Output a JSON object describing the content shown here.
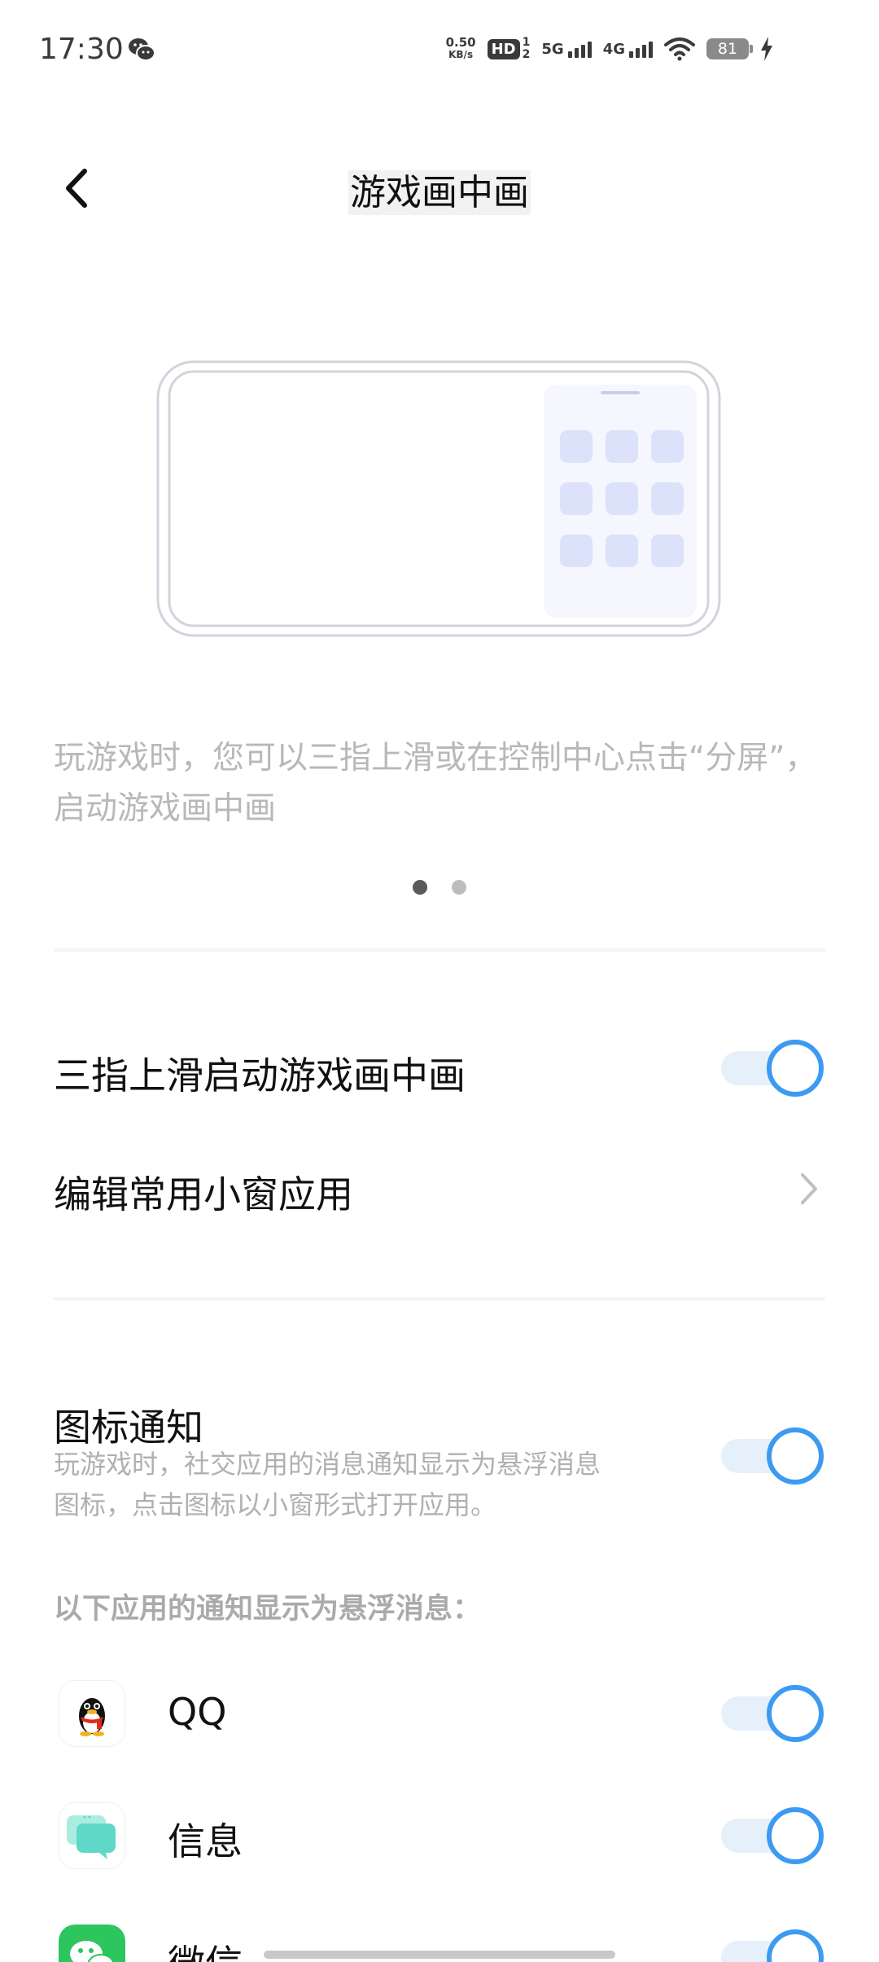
{
  "status_bar": {
    "time": "17:30",
    "net_speed_value": "0.50",
    "net_speed_unit": "KB/s",
    "hd_label": "HD",
    "hd_sub_top": "1",
    "hd_sub_bottom": "2",
    "signal1_label": "5G",
    "signal2_label": "4G",
    "battery": "81",
    "icons": [
      "wechat-icon",
      "wifi-icon",
      "charging-icon"
    ]
  },
  "header": {
    "title": "游戏画中画",
    "back_icon": "chevron-left-icon"
  },
  "intro": {
    "description": "玩游戏时，您可以三指上滑或在控制中心点击“分屏”，启动游戏画中画",
    "page_count": 2,
    "active_page": 1
  },
  "settings": {
    "three_finger": {
      "label": "三指上滑启动游戏画中画",
      "enabled": true
    },
    "edit_apps": {
      "label": "编辑常用小窗应用"
    },
    "icon_notify": {
      "label": "图标通知",
      "description": "玩游戏时，社交应用的消息通知显示为悬浮消息图标，点击图标以小窗形式打开应用。",
      "enabled": true
    }
  },
  "apps_section": {
    "label": "以下应用的通知显示为悬浮消息：",
    "apps": [
      {
        "name": "QQ",
        "icon": "qq-penguin-icon",
        "enabled": true
      },
      {
        "name": "信息",
        "icon": "messages-icon",
        "enabled": true
      },
      {
        "name": "微信",
        "icon": "wechat-icon",
        "enabled": true
      }
    ]
  },
  "colors": {
    "accent": "#3d9af2",
    "toggle_track": "#e6f0fb",
    "muted_text": "#b8b8b8"
  }
}
